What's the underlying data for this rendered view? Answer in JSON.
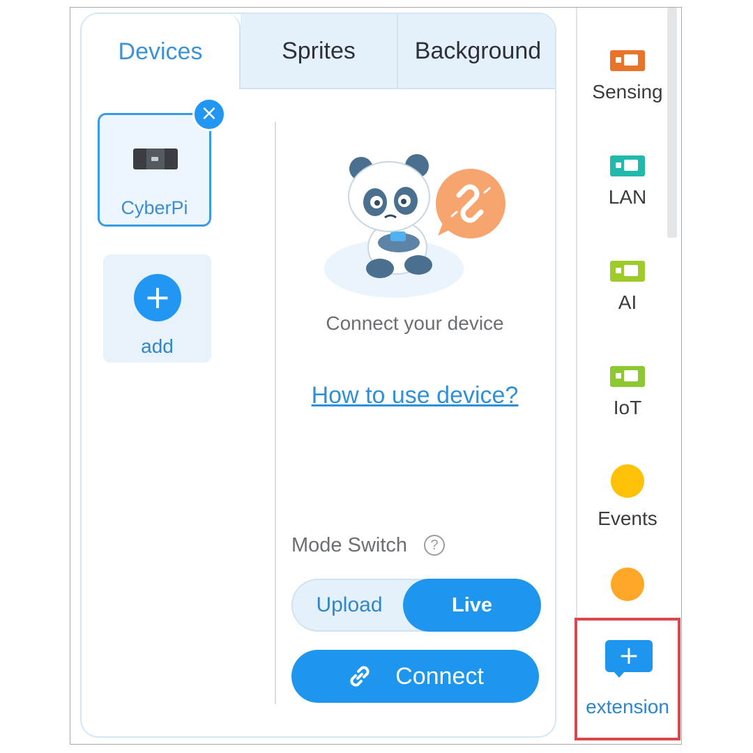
{
  "tabs": [
    {
      "label": "Devices"
    },
    {
      "label": "Sprites"
    },
    {
      "label": "Background"
    }
  ],
  "devices": {
    "items": [
      {
        "name": "CyberPi"
      }
    ],
    "remove_icon": "×",
    "add_icon": "+",
    "add_label": "add"
  },
  "connection": {
    "status_text": "Connect your device",
    "help_link": "How to use device?",
    "mode_label": "Mode Switch",
    "mode_help_icon": "?",
    "modes": [
      "Upload",
      "Live"
    ],
    "selected_mode": "Live",
    "connect_label": "Connect"
  },
  "categories": [
    {
      "label": "Sensing",
      "icon": "chip-icon",
      "color": "#e8742a"
    },
    {
      "label": "LAN",
      "icon": "chip-icon",
      "color": "#22b9ad"
    },
    {
      "label": "AI",
      "icon": "chip-icon",
      "color": "#9fcb2a"
    },
    {
      "label": "IoT",
      "icon": "chip-icon",
      "color": "#8bc832"
    },
    {
      "label": "Events",
      "icon": "dot-icon",
      "color": "#ffc107"
    },
    {
      "label": "",
      "icon": "dot-icon",
      "color": "#ffa726"
    }
  ],
  "extension": {
    "icon": "+",
    "label": "extension"
  },
  "colors": {
    "accent": "#1e96ee",
    "highlight_border": "#d9474e"
  }
}
